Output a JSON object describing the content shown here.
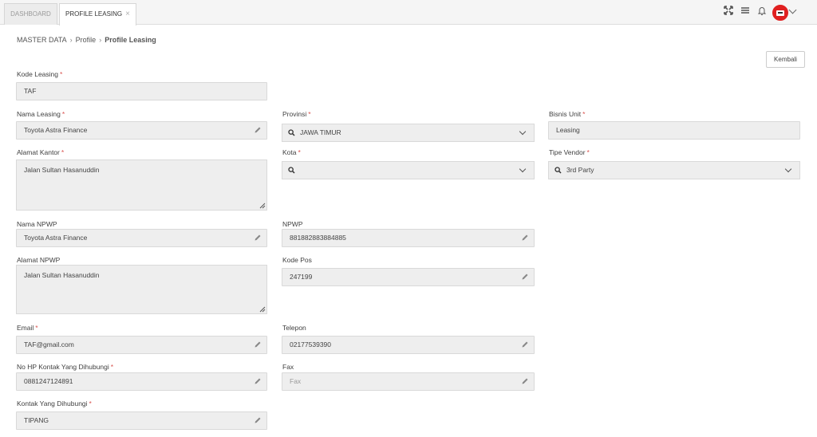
{
  "tabs": [
    {
      "label": "DASHBOARD"
    },
    {
      "label": "PROFILE LEASING",
      "close": "×"
    }
  ],
  "top_icons": [
    "expand-icon",
    "menu-icon",
    "bell-icon",
    "user-avatar-icon",
    "chevron-down-icon"
  ],
  "breadcrumb": {
    "root": "MASTER DATA",
    "mid": "Profile",
    "current": "Profile Leasing",
    "sep": "›"
  },
  "back_button": "Kembali",
  "required_mark": "*",
  "fields": {
    "kode_leasing": {
      "label": "Kode Leasing",
      "value": "TAF"
    },
    "nama_leasing": {
      "label": "Nama Leasing",
      "value": "Toyota Astra Finance"
    },
    "provinsi": {
      "label": "Provinsi",
      "value": "JAWA TIMUR"
    },
    "bisnis_unit": {
      "label": "Bisnis Unit",
      "value": "Leasing"
    },
    "alamat_kantor": {
      "label": "Alamat Kantor",
      "value": "Jalan Sultan Hasanuddin"
    },
    "kota": {
      "label": "Kota",
      "value": ""
    },
    "tipe_vendor": {
      "label": "Tipe Vendor",
      "value": "3rd Party"
    },
    "nama_npwp": {
      "label": "Nama NPWP",
      "value": "Toyota Astra Finance"
    },
    "npwp": {
      "label": "NPWP",
      "value": "881882883884885"
    },
    "alamat_npwp": {
      "label": "Alamat NPWP",
      "value": "Jalan Sultan Hasanuddin"
    },
    "kode_pos": {
      "label": "Kode Pos",
      "value": "247199"
    },
    "email": {
      "label": "Email",
      "value": "TAF@gmail.com"
    },
    "telepon": {
      "label": "Telepon",
      "value": "02177539390"
    },
    "no_hp": {
      "label": "No HP Kontak Yang Dihubungi",
      "value": "0881247124891"
    },
    "fax": {
      "label": "Fax",
      "placeholder": "Fax"
    },
    "kontak": {
      "label": "Kontak Yang Dihubungi",
      "value": "TIPANG"
    }
  },
  "colors": {
    "required": "#d9534f",
    "avatar": "#e02020",
    "field_bg": "#eeeeee"
  }
}
